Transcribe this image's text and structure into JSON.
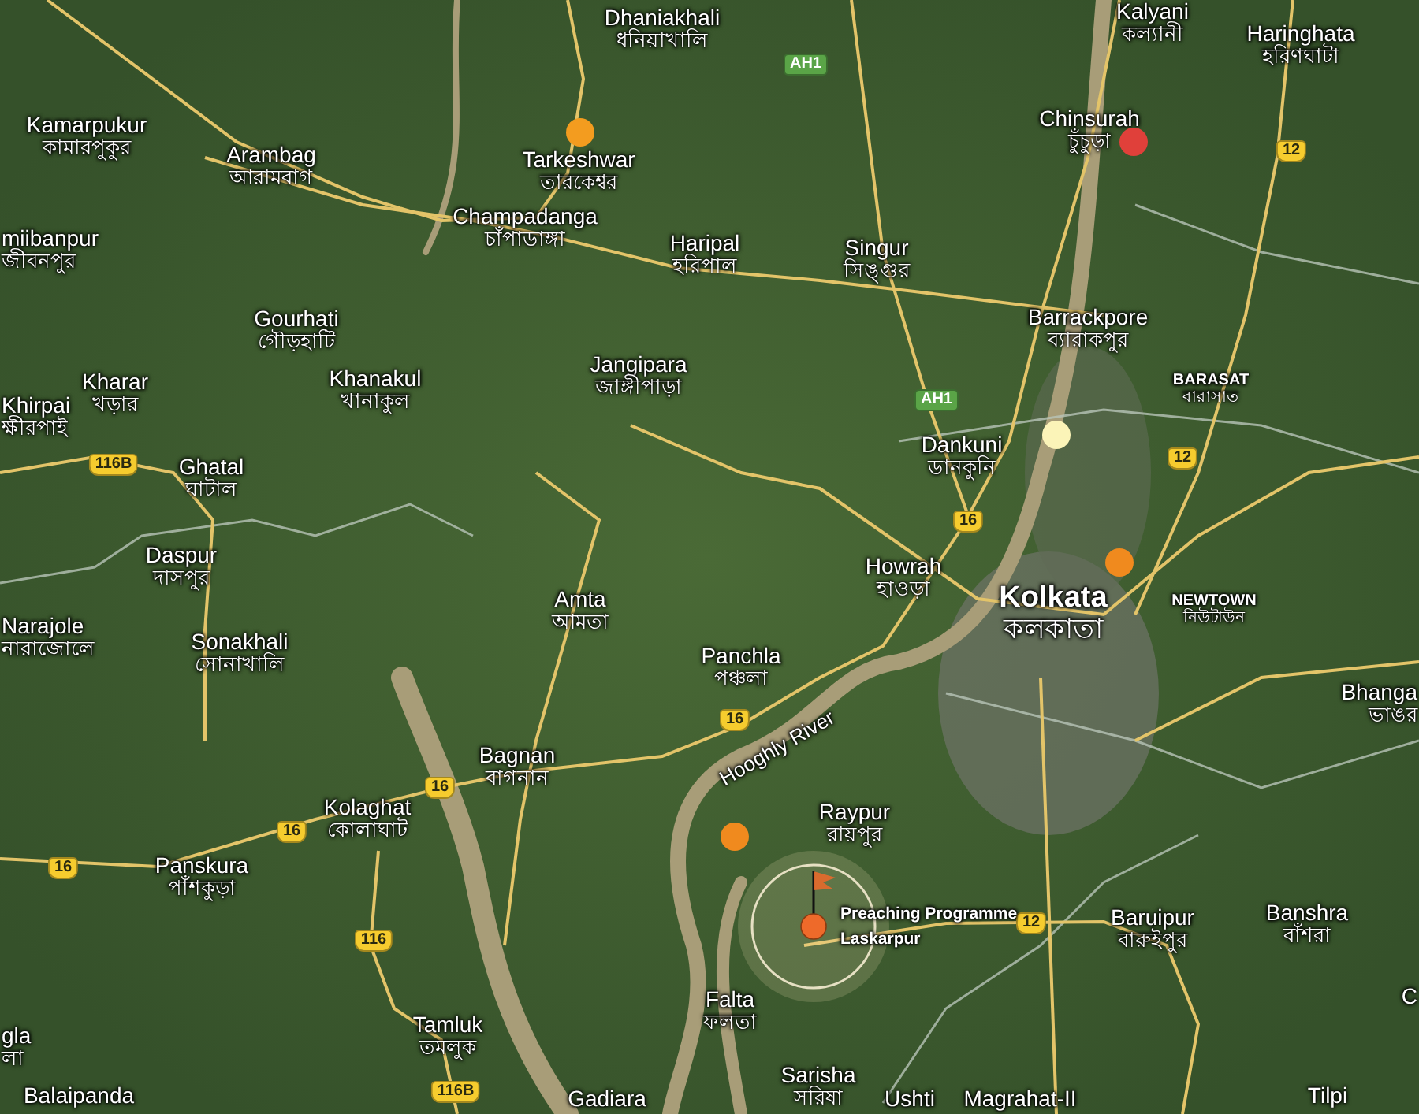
{
  "map": {
    "places": [
      {
        "name": "Dhaniakhali",
        "local": "ধনিয়াখালি"
      },
      {
        "name": "Kalyani",
        "local": "কল্যানী"
      },
      {
        "name": "Haringhata",
        "local": "হরিণঘাটা"
      },
      {
        "name": "Kamarpukur",
        "local": "কামারপুকুর"
      },
      {
        "name": "Arambag",
        "local": "আরামবাগ"
      },
      {
        "name": "Tarkeshwar",
        "local": "তারকেশ্বর"
      },
      {
        "name": "Chinsurah",
        "local": "চুঁচুড়া"
      },
      {
        "name": "Champadanga",
        "local": "চাঁপাডাঙ্গা"
      },
      {
        "name": "miibanpur",
        "local": "জীবনপুর"
      },
      {
        "name": "Haripal",
        "local": "হরিপাল"
      },
      {
        "name": "Singur",
        "local": "সিঙ্গুর"
      },
      {
        "name": "Gourhati",
        "local": "গৌড়হাটি"
      },
      {
        "name": "Barrackpore",
        "local": "ব্যারাকপুর"
      },
      {
        "name": "Jangipara",
        "local": "জাঙ্গীপাড়া"
      },
      {
        "name": "Kharar",
        "local": "খড়ার"
      },
      {
        "name": "Khanakul",
        "local": "খানাকুল"
      },
      {
        "name": "BARASAT",
        "local": "বারাসাত"
      },
      {
        "name": "Khirpai",
        "local": "ক্ষীরপাই"
      },
      {
        "name": "Dankuni",
        "local": "ডানকুনি"
      },
      {
        "name": "Ghatal",
        "local": "ঘাটাল"
      },
      {
        "name": "Daspur",
        "local": "দাসপুর"
      },
      {
        "name": "Howrah",
        "local": "হাওড়া"
      },
      {
        "name": "Kolkata",
        "local": "কলকাতা"
      },
      {
        "name": "NEWTOWN",
        "local": "নিউটাউন"
      },
      {
        "name": "Narajole",
        "local": "নারাজোলে"
      },
      {
        "name": "Amta",
        "local": "আমতা"
      },
      {
        "name": "Sonakhali",
        "local": "সোনাখালি"
      },
      {
        "name": "Panchla",
        "local": "পঞ্চলা"
      },
      {
        "name": "Bhanga",
        "local": "ভাঙর"
      },
      {
        "name": "Bagnan",
        "local": "বাগনান"
      },
      {
        "name": "Kolaghat",
        "local": "কোলাঘাট"
      },
      {
        "name": "Raypur",
        "local": "রায়পুর"
      },
      {
        "name": "Panskura",
        "local": "পাঁশকুড়া"
      },
      {
        "name": "Baruipur",
        "local": "বারুইপুর"
      },
      {
        "name": "Banshra",
        "local": "বাঁশরা"
      },
      {
        "name": "Falta",
        "local": "ফলতা"
      },
      {
        "name": "gla",
        "local": "লা"
      },
      {
        "name": "Tamluk",
        "local": "তমলুক"
      },
      {
        "name": "Balaipanda"
      },
      {
        "name": "Gadiara"
      },
      {
        "name": "Sarisha",
        "local": "সরিষা"
      },
      {
        "name": "Ushti"
      },
      {
        "name": "Magrahat-II"
      },
      {
        "name": "Tilpi"
      },
      {
        "name": "C"
      }
    ],
    "river_label": "Hooghly River",
    "shields": [
      {
        "label": "AH1",
        "kind": "asian"
      },
      {
        "label": "AH1",
        "kind": "asian"
      },
      {
        "label": "12",
        "kind": "national"
      },
      {
        "label": "12",
        "kind": "national"
      },
      {
        "label": "12",
        "kind": "national"
      },
      {
        "label": "16",
        "kind": "national"
      },
      {
        "label": "16",
        "kind": "national"
      },
      {
        "label": "16",
        "kind": "national"
      },
      {
        "label": "16",
        "kind": "national"
      },
      {
        "label": "16",
        "kind": "national"
      },
      {
        "label": "116B",
        "kind": "national"
      },
      {
        "label": "116B",
        "kind": "national"
      },
      {
        "label": "116",
        "kind": "national"
      }
    ],
    "markers": [
      {
        "kind": "dot",
        "color": "#f39c1f"
      },
      {
        "kind": "dot",
        "color": "#e0403a"
      },
      {
        "kind": "dot",
        "color": "#fbf4b8"
      },
      {
        "kind": "dot",
        "color": "#f08a1e"
      },
      {
        "kind": "dot",
        "color": "#f08a1e"
      },
      {
        "kind": "flag",
        "color": "#ee6a2a"
      }
    ],
    "event": {
      "title": "Preaching Programme",
      "place": "Laskarpur"
    }
  }
}
